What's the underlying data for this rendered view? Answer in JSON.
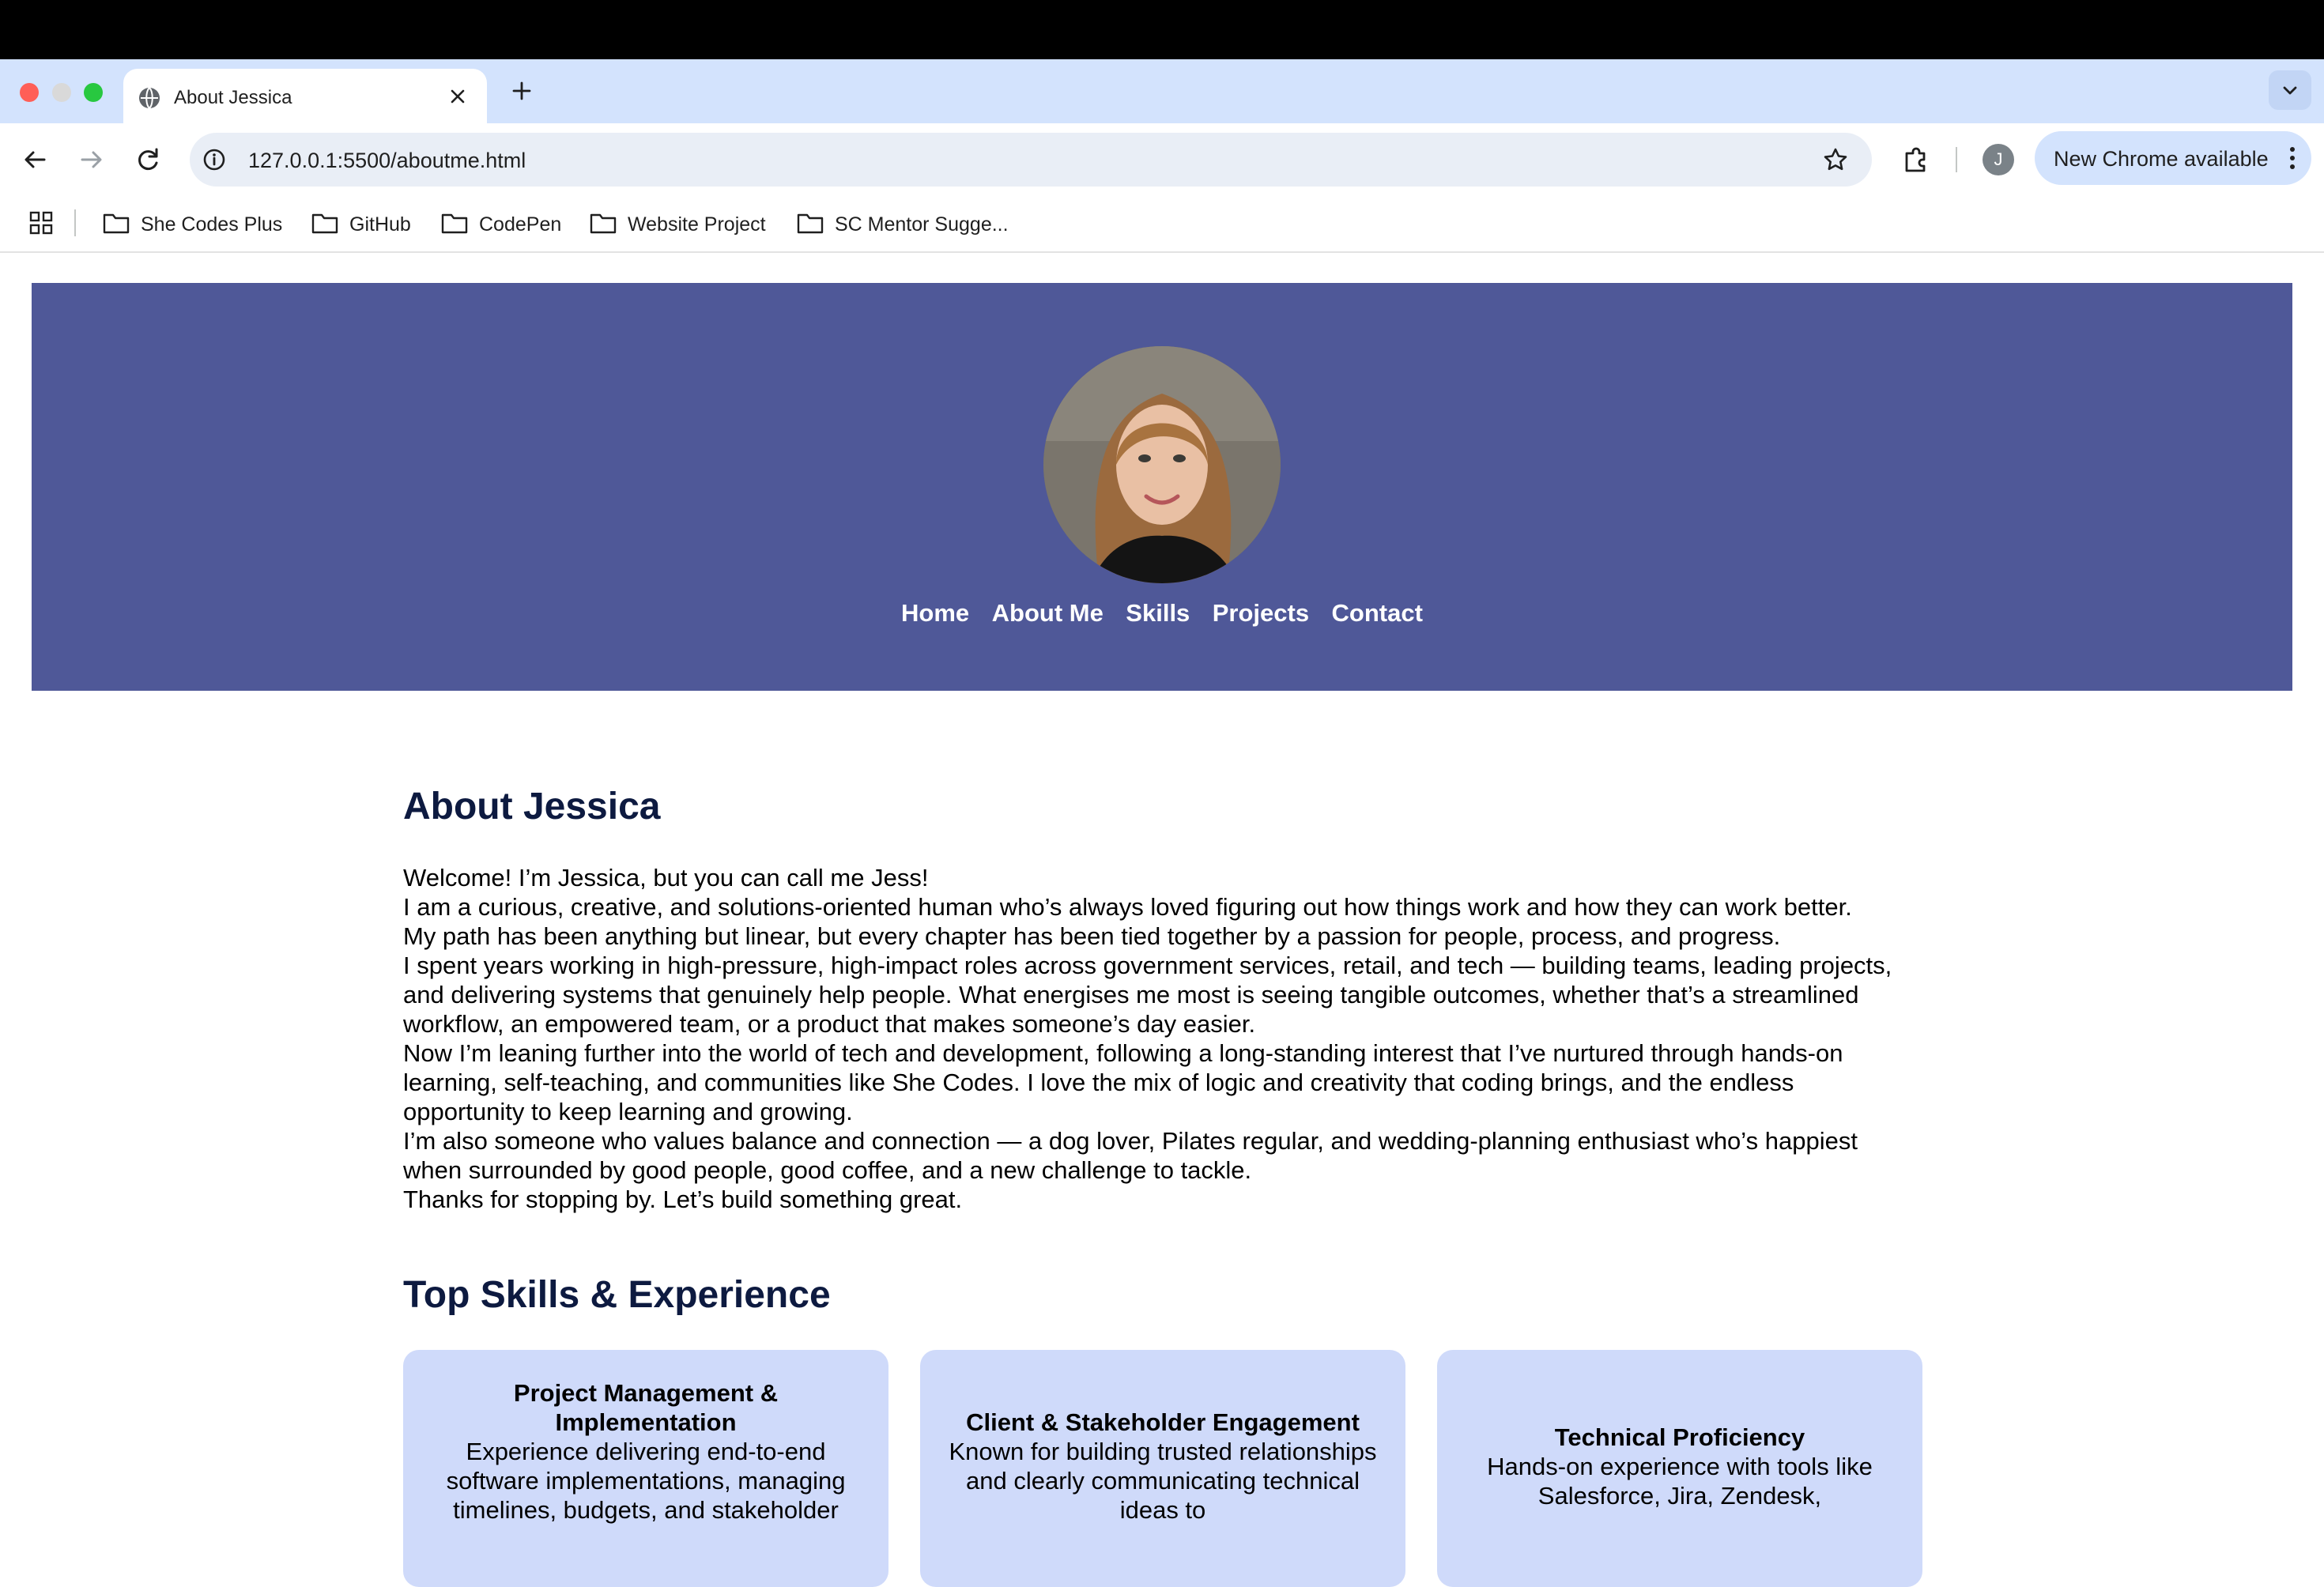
{
  "browser": {
    "tab": {
      "title": "About Jessica"
    },
    "address_bar": {
      "url": "127.0.0.1:5500/aboutme.html"
    },
    "profile_initial": "J",
    "update_button_label": "New Chrome available",
    "bookmarks": [
      {
        "label": "She Codes Plus"
      },
      {
        "label": "GitHub"
      },
      {
        "label": "CodePen"
      },
      {
        "label": "Website Project"
      },
      {
        "label": "SC Mentor Sugge..."
      }
    ]
  },
  "page": {
    "accent_color": "#4f5898",
    "nav": [
      "Home",
      "About Me",
      "Skills",
      "Projects",
      "Contact"
    ],
    "about": {
      "heading": "About Jessica",
      "paragraphs": [
        "Welcome! I’m Jessica, but you can call me Jess!",
        "I am a curious, creative, and solutions-oriented human who’s always loved figuring out how things work and how they can work better.",
        "My path has been anything but linear, but every chapter has been tied together by a passion for people, process, and progress.",
        "I spent years working in high-pressure, high-impact roles across government services, retail, and tech — building teams, leading projects, and delivering systems that genuinely help people. What energises me most is seeing tangible outcomes, whether that’s a streamlined workflow, an empowered team, or a product that makes someone’s day easier.",
        "Now I’m leaning further into the world of tech and development, following a long-standing interest that I’ve nurtured through hands-on learning, self-teaching, and communities like She Codes. I love the mix of logic and creativity that coding brings, and the endless opportunity to keep learning and growing.",
        "I’m also someone who values balance and connection — a dog lover, Pilates regular, and wedding-planning enthusiast who’s happiest when surrounded by good people, good coffee, and a new challenge to tackle.",
        "Thanks for stopping by. Let’s build something great."
      ]
    },
    "skills": {
      "heading": "Top Skills & Experience",
      "cards": [
        {
          "title": "Project Management & Implementation",
          "description": "Experience delivering end-to-end software implementations, managing timelines, budgets, and stakeholder"
        },
        {
          "title": "Client & Stakeholder Engagement",
          "description": "Known for building trusted relationships and clearly communicating technical ideas to"
        },
        {
          "title": "Technical Proficiency",
          "description": "Hands-on experience with tools like Salesforce, Jira, Zendesk,"
        }
      ]
    }
  }
}
